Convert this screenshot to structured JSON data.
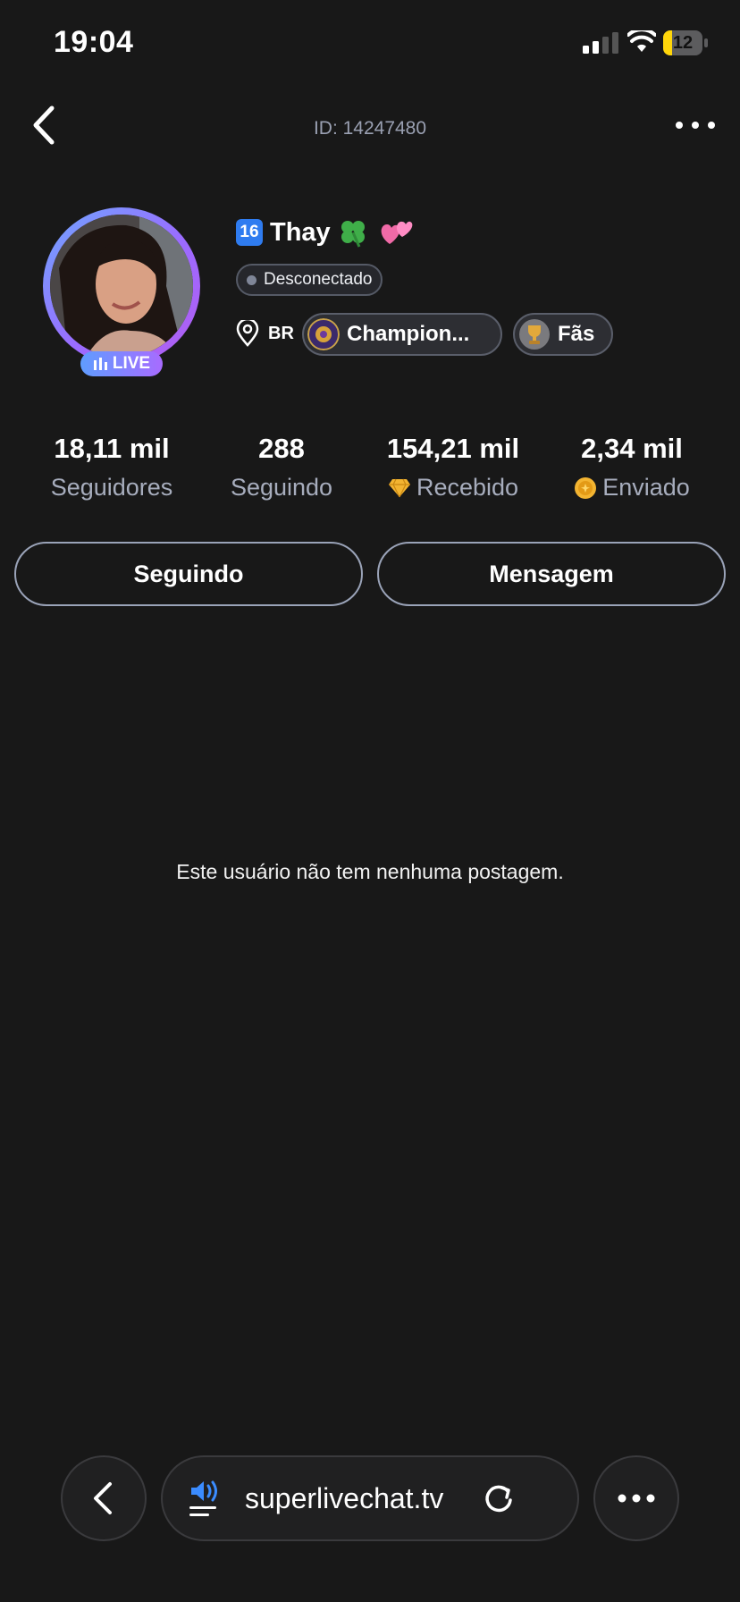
{
  "status_bar": {
    "time": "19:04",
    "battery": "12"
  },
  "header": {
    "user_id": "ID: 14247480"
  },
  "profile": {
    "level": "16",
    "name": "Thay",
    "live_label": "LIVE",
    "status": "Desconectado",
    "country": "BR",
    "badge_1": "Champion...",
    "badge_2": "Fãs"
  },
  "stats": [
    {
      "value": "18,11 mil",
      "label": "Seguidores"
    },
    {
      "value": "288",
      "label": "Seguindo"
    },
    {
      "value": "154,21 mil",
      "label": "Recebido",
      "icon": "diamond-icon"
    },
    {
      "value": "2,34 mil",
      "label": "Enviado",
      "icon": "coin-icon"
    }
  ],
  "actions": {
    "follow_label": "Seguindo",
    "message_label": "Mensagem"
  },
  "empty_state": "Este usuário não tem nenhuma postagem.",
  "browser": {
    "url": "superlivechat.tv"
  },
  "colors": {
    "background": "#181818",
    "accent_blue": "#2f7cf0",
    "live_gradient_start": "#5f9dff",
    "live_gradient_end": "#a86bff"
  }
}
